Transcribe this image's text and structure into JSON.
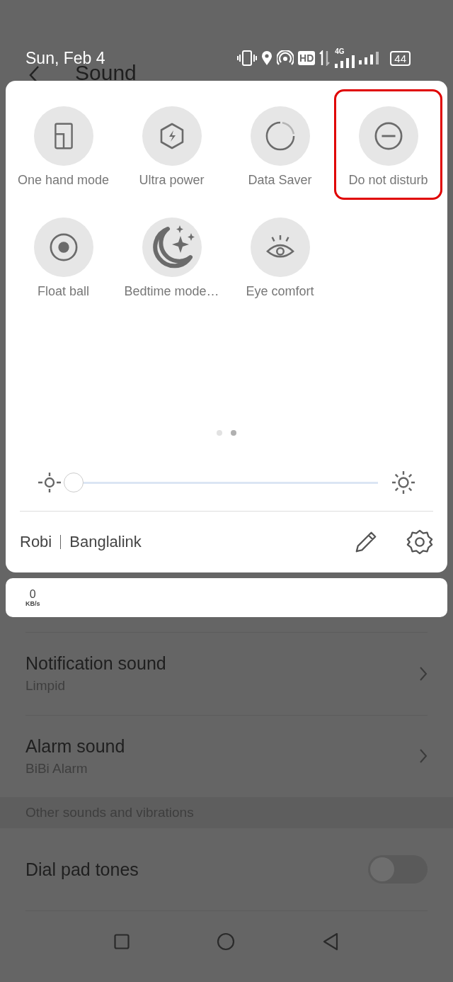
{
  "status_bar": {
    "date": "Sun, Feb 4",
    "hd": "HD",
    "network": "4G",
    "battery": "44"
  },
  "page": {
    "title": "Sound",
    "rows": [
      {
        "kind": "link",
        "title": "Notification sound",
        "subtitle": "Limpid"
      },
      {
        "kind": "link",
        "title": "Alarm sound",
        "subtitle": "BiBi Alarm"
      },
      {
        "kind": "section",
        "title": "Other sounds and vibrations"
      },
      {
        "kind": "toggle",
        "title": "Dial pad tones",
        "on": false
      }
    ]
  },
  "quick_panel": {
    "tiles": [
      {
        "label": "One hand mode",
        "highlighted": false
      },
      {
        "label": "Ultra power",
        "highlighted": false
      },
      {
        "label": "Data Saver",
        "highlighted": false
      },
      {
        "label": "Do not disturb",
        "highlighted": true
      },
      {
        "label": "Float ball",
        "highlighted": false
      },
      {
        "label": "Bedtime mode…",
        "highlighted": false
      },
      {
        "label": "Eye comfort",
        "highlighted": false
      }
    ],
    "pages": [
      {
        "selected": false
      },
      {
        "selected": true
      }
    ],
    "brightness": {
      "level": 0
    },
    "carriers": [
      "Robi",
      "Banglalink"
    ]
  },
  "data_speed": {
    "value": "0",
    "unit": "KB/s"
  }
}
